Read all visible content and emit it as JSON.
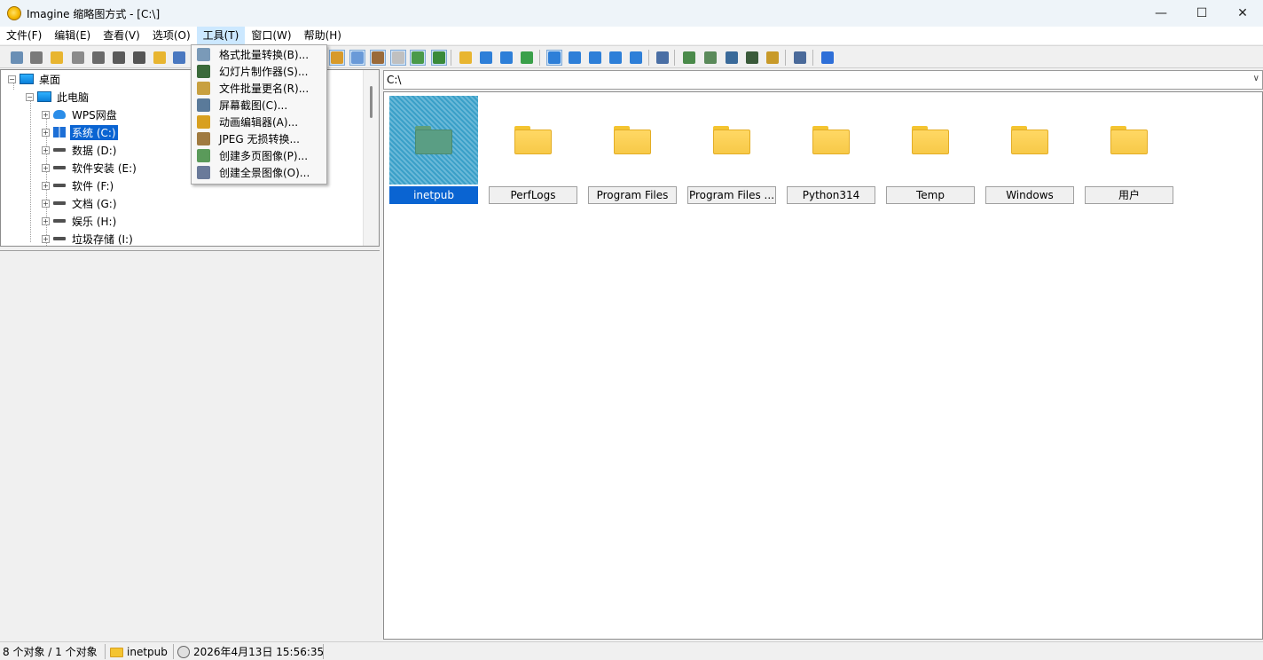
{
  "window": {
    "title": "Imagine 缩略图方式 - [C:\\]",
    "minimize": "—",
    "maximize": "☐",
    "close": "✕"
  },
  "menubar": {
    "items": [
      "文件(F)",
      "编辑(E)",
      "查看(V)",
      "选项(O)",
      "工具(T)",
      "窗口(W)",
      "帮助(H)"
    ],
    "active": "工具(T)"
  },
  "toolbar": {
    "buttons": [
      {
        "icon": "eye-icon",
        "color": "#6a8fb5"
      },
      {
        "icon": "browse-icon",
        "color": "#7a7a7a"
      },
      {
        "icon": "open-folder-icon",
        "color": "#e8b530"
      },
      {
        "icon": "copy-icon",
        "color": "#8a8a8a"
      },
      {
        "icon": "print-icon",
        "color": "#6a6a6a"
      },
      {
        "icon": "info-icon",
        "color": "#5a5a5a"
      },
      {
        "icon": "camera-icon",
        "color": "#555555"
      },
      {
        "icon": "new-folder-icon",
        "color": "#e8b530"
      },
      {
        "icon": "rename-icon",
        "color": "#4a78c0"
      }
    ],
    "buttons_right": [
      {
        "icon": "tree-icon",
        "color": "#d89a2a",
        "pressed": true
      },
      {
        "icon": "circle-icon",
        "color": "#6a9ad8",
        "pressed": true
      },
      {
        "icon": "panel-icon",
        "color": "#9a6a3a",
        "pressed": true
      },
      {
        "icon": "grid-view-icon",
        "color": "#c0c0c0",
        "pressed": true
      },
      {
        "icon": "fit-icon",
        "color": "#4a9a4a",
        "pressed": true
      },
      {
        "icon": "image-icon",
        "color": "#3a8a3a",
        "pressed": true
      },
      {
        "icon": "up-folder-icon",
        "color": "#e8b530"
      },
      {
        "icon": "back-arrow-icon",
        "color": "#2e7fd8"
      },
      {
        "icon": "forward-arrow-icon",
        "color": "#2e7fd8"
      },
      {
        "icon": "refresh-icon",
        "color": "#3aa04a"
      },
      {
        "icon": "large-icons-view-icon",
        "color": "#2e7fd8",
        "pressed": true
      },
      {
        "icon": "small-icons-view-icon",
        "color": "#2e7fd8"
      },
      {
        "icon": "list-view-icon",
        "color": "#2e7fd8"
      },
      {
        "icon": "details-view-icon",
        "color": "#2e7fd8"
      },
      {
        "icon": "table-view-icon",
        "color": "#2e7fd8"
      },
      {
        "icon": "wrench-icon",
        "color": "#4a6fa5"
      },
      {
        "icon": "convert-icon",
        "color": "#4a8a4a"
      },
      {
        "icon": "slideshow-icon",
        "color": "#5a8a5a"
      },
      {
        "icon": "screenshot-icon",
        "color": "#3a6a9a"
      },
      {
        "icon": "filmstrip-icon",
        "color": "#3a5a3a"
      },
      {
        "icon": "edit-icon",
        "color": "#c89a2a"
      },
      {
        "icon": "notes-icon",
        "color": "#4a6a9a"
      },
      {
        "icon": "help-icon",
        "color": "#2e6fd8"
      }
    ]
  },
  "tools_menu": {
    "items": [
      {
        "label": "格式批量转换(B)...",
        "icon": "batch-convert-icon",
        "color": "#7a9ab8"
      },
      {
        "label": "幻灯片制作器(S)...",
        "icon": "slideshow-maker-icon",
        "color": "#3a6a3a"
      },
      {
        "label": "文件批量更名(R)...",
        "icon": "batch-rename-icon",
        "color": "#c8a040"
      },
      {
        "label": "屏幕截图(C)...",
        "icon": "screen-capture-icon",
        "color": "#5a7a9a"
      },
      {
        "label": "动画编辑器(A)...",
        "icon": "animation-editor-icon",
        "color": "#d8a020"
      },
      {
        "label": "JPEG 无损转换...",
        "icon": "jpeg-lossless-icon",
        "color": "#a07a40"
      },
      {
        "label": "创建多页图像(P)...",
        "icon": "multipage-icon",
        "color": "#5a9a5a"
      },
      {
        "label": "创建全景图像(O)...",
        "icon": "panorama-icon",
        "color": "#6a7a9a"
      }
    ]
  },
  "tree": {
    "desktop": "桌面",
    "this_pc": "此电脑",
    "drives": [
      {
        "label": "WPS网盘",
        "icon": "cloud-icon"
      },
      {
        "label": "系统 (C:)",
        "icon": "windows-drive-icon",
        "selected": true
      },
      {
        "label": "数据 (D:)",
        "icon": "drive-icon"
      },
      {
        "label": "软件安装 (E:)",
        "icon": "drive-icon"
      },
      {
        "label": "软件 (F:)",
        "icon": "drive-icon"
      },
      {
        "label": "文档 (G:)",
        "icon": "drive-icon"
      },
      {
        "label": "娱乐 (H:)",
        "icon": "drive-icon"
      },
      {
        "label": "垃圾存储 (I:)",
        "icon": "drive-icon"
      }
    ]
  },
  "path": {
    "value": "C:\\"
  },
  "thumbnails": [
    {
      "label": "inetpub",
      "selected": true
    },
    {
      "label": "PerfLogs"
    },
    {
      "label": "Program Files"
    },
    {
      "label": "Program Files ..."
    },
    {
      "label": "Python314"
    },
    {
      "label": "Temp"
    },
    {
      "label": "Windows"
    },
    {
      "label": "用户"
    }
  ],
  "status": {
    "count": "8 个对象 / 1 个对象",
    "folder": "inetpub",
    "datetime": "2026年4月13日 15:56:35"
  }
}
